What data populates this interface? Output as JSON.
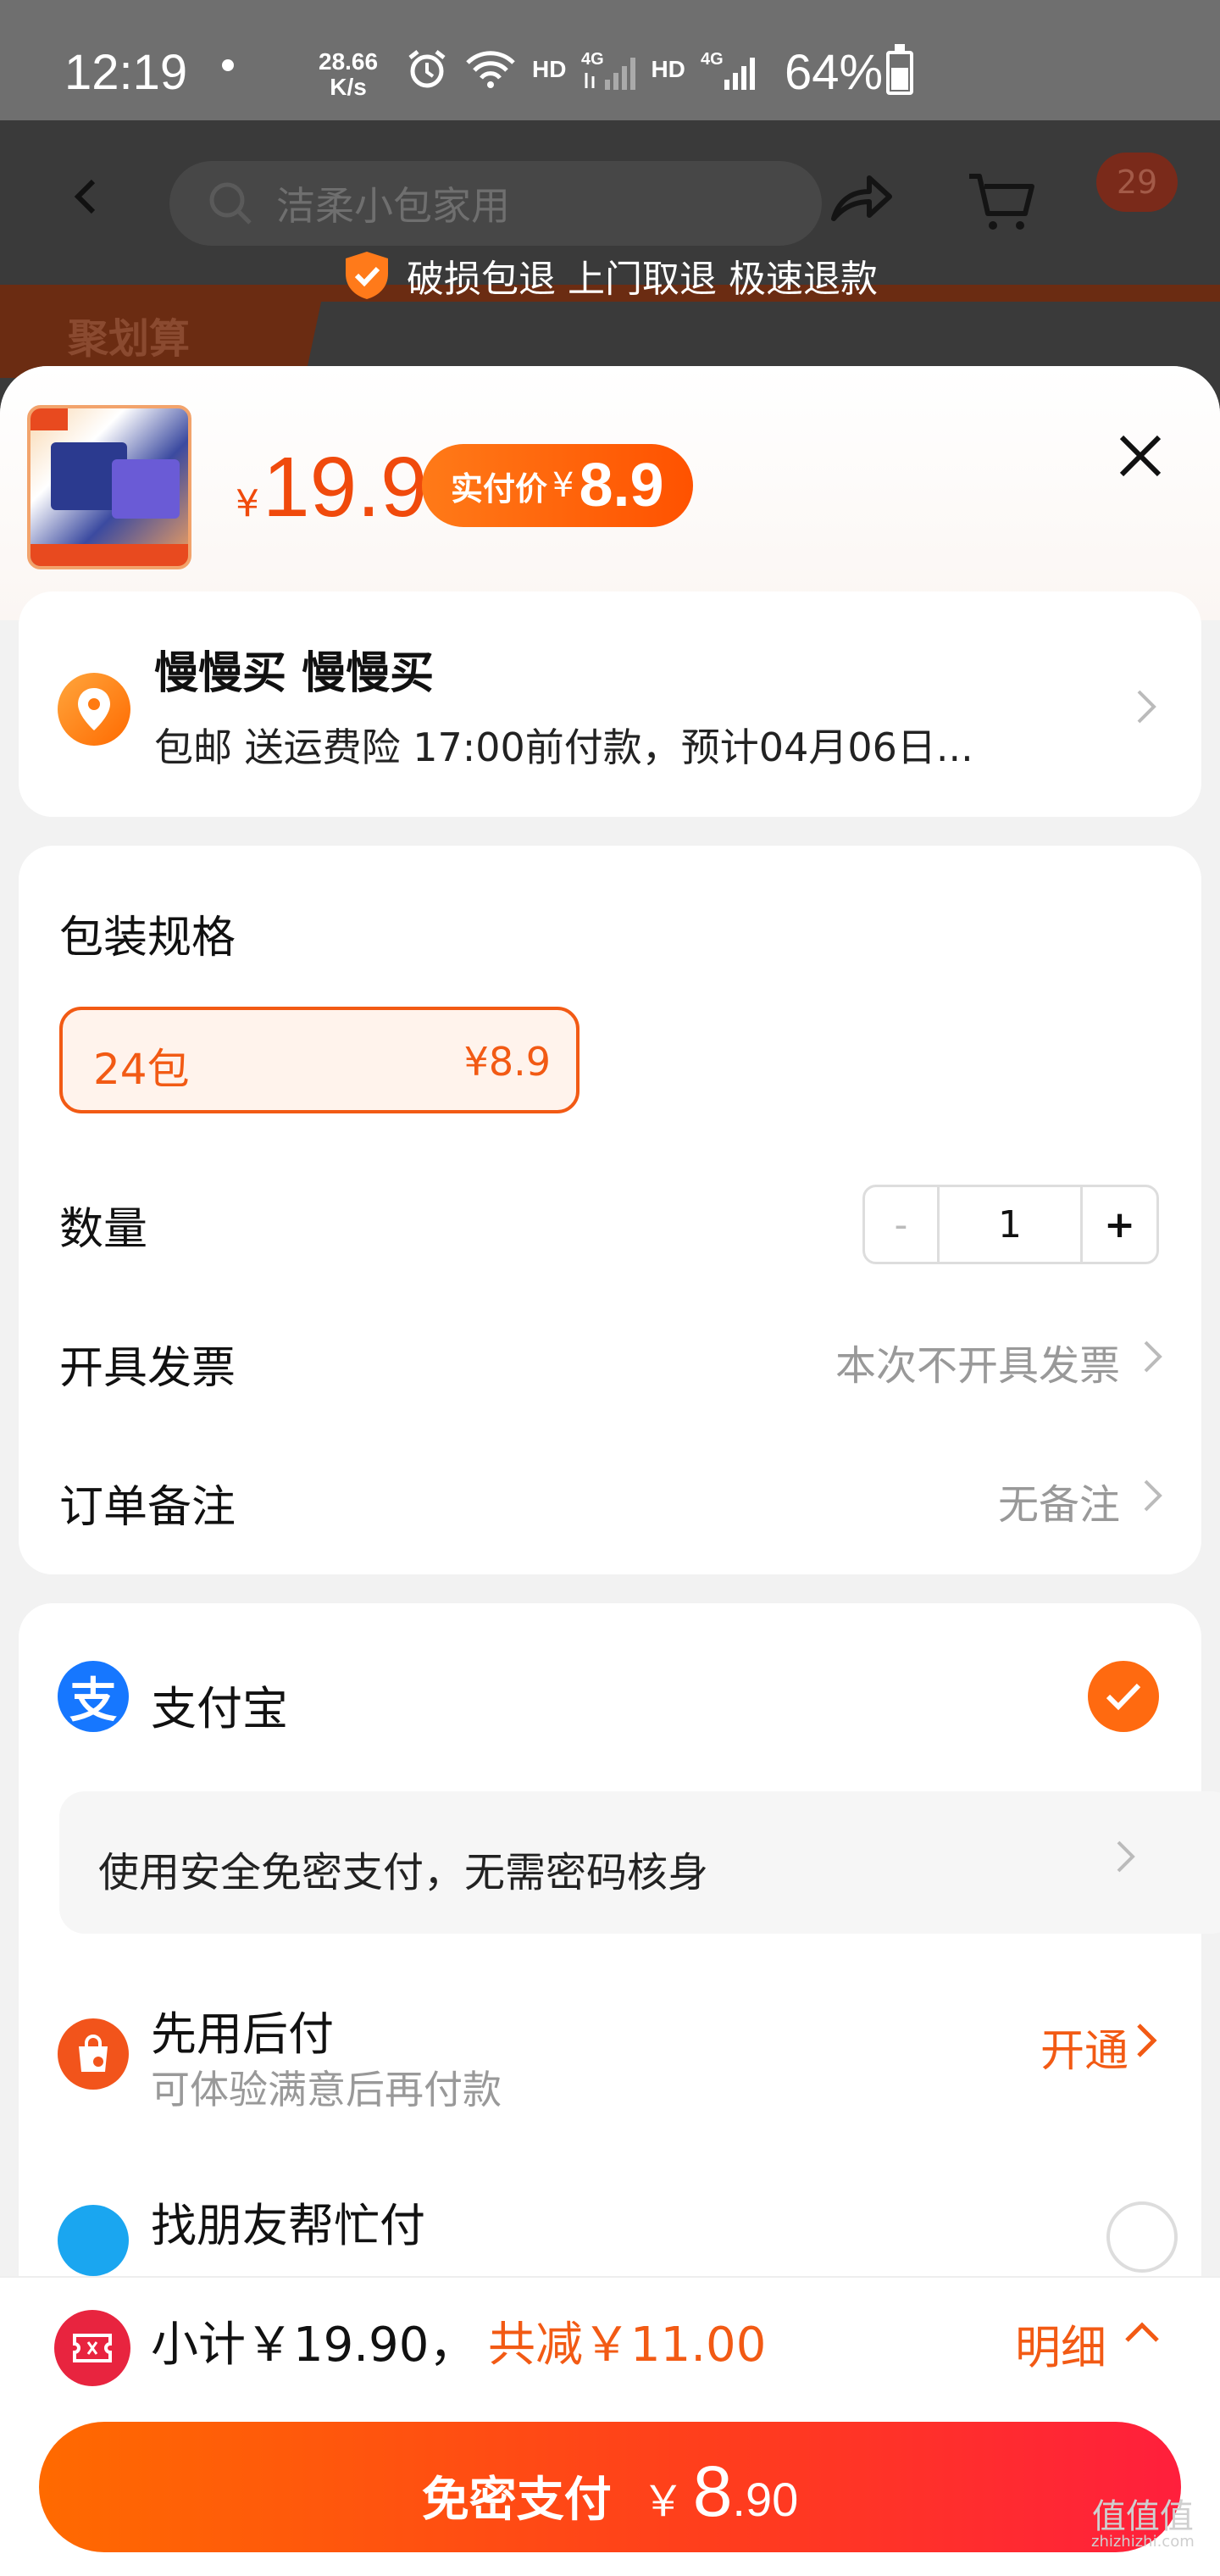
{
  "status_bar": {
    "time": "12:19",
    "net_speed_value": "28.66",
    "net_speed_unit": "K/s",
    "hd1": "HD",
    "hd2": "HD",
    "battery": "64%"
  },
  "header": {
    "search_placeholder": "洁柔小包家用",
    "cart_badge": "29",
    "promo_label": "聚划算",
    "guarantee": "破损包退 上门取退 极速退款"
  },
  "product": {
    "price_symbol": "¥",
    "price": "19.9",
    "actual_pay_label": "实付价",
    "actual_pay_symbol": "¥",
    "actual_pay_value": "8.9"
  },
  "address": {
    "name": "慢慢买 慢慢买",
    "detail": "包邮  送运费险  17:00前付款，预计04月06日..."
  },
  "spec": {
    "title": "包装规格",
    "option_name": "24包",
    "option_price": "¥8.9",
    "quantity_label": "数量",
    "minus": "-",
    "quantity": "1",
    "plus": "+",
    "invoice_label": "开具发票",
    "invoice_value": "本次不开具发票",
    "remark_label": "订单备注",
    "remark_value": "无备注"
  },
  "payment": {
    "alipay_glyph": "支",
    "alipay_name": "支付宝",
    "secure_text": "使用安全免密支付，无需密码核身",
    "later_title": "先用后付",
    "later_sub": "可体验满意后再付款",
    "later_action": "开通",
    "friend_title": "找朋友帮忙付"
  },
  "bottom": {
    "subtotal": "小计￥19.90，",
    "discount": "共减￥11.00",
    "detail": "明细",
    "pay_label": "免密支付",
    "pay_symbol": "￥",
    "pay_int": "8",
    "pay_dec": ".90"
  },
  "watermark": {
    "main": "值值值",
    "sub": "zhizhizhi.com"
  },
  "colors": {
    "accent": "#f25a14",
    "price_red": "#f04a0c",
    "alipay_blue": "#1677ff",
    "pay_gradient_start": "#ff6a00",
    "pay_gradient_end": "#ff1f3c"
  }
}
